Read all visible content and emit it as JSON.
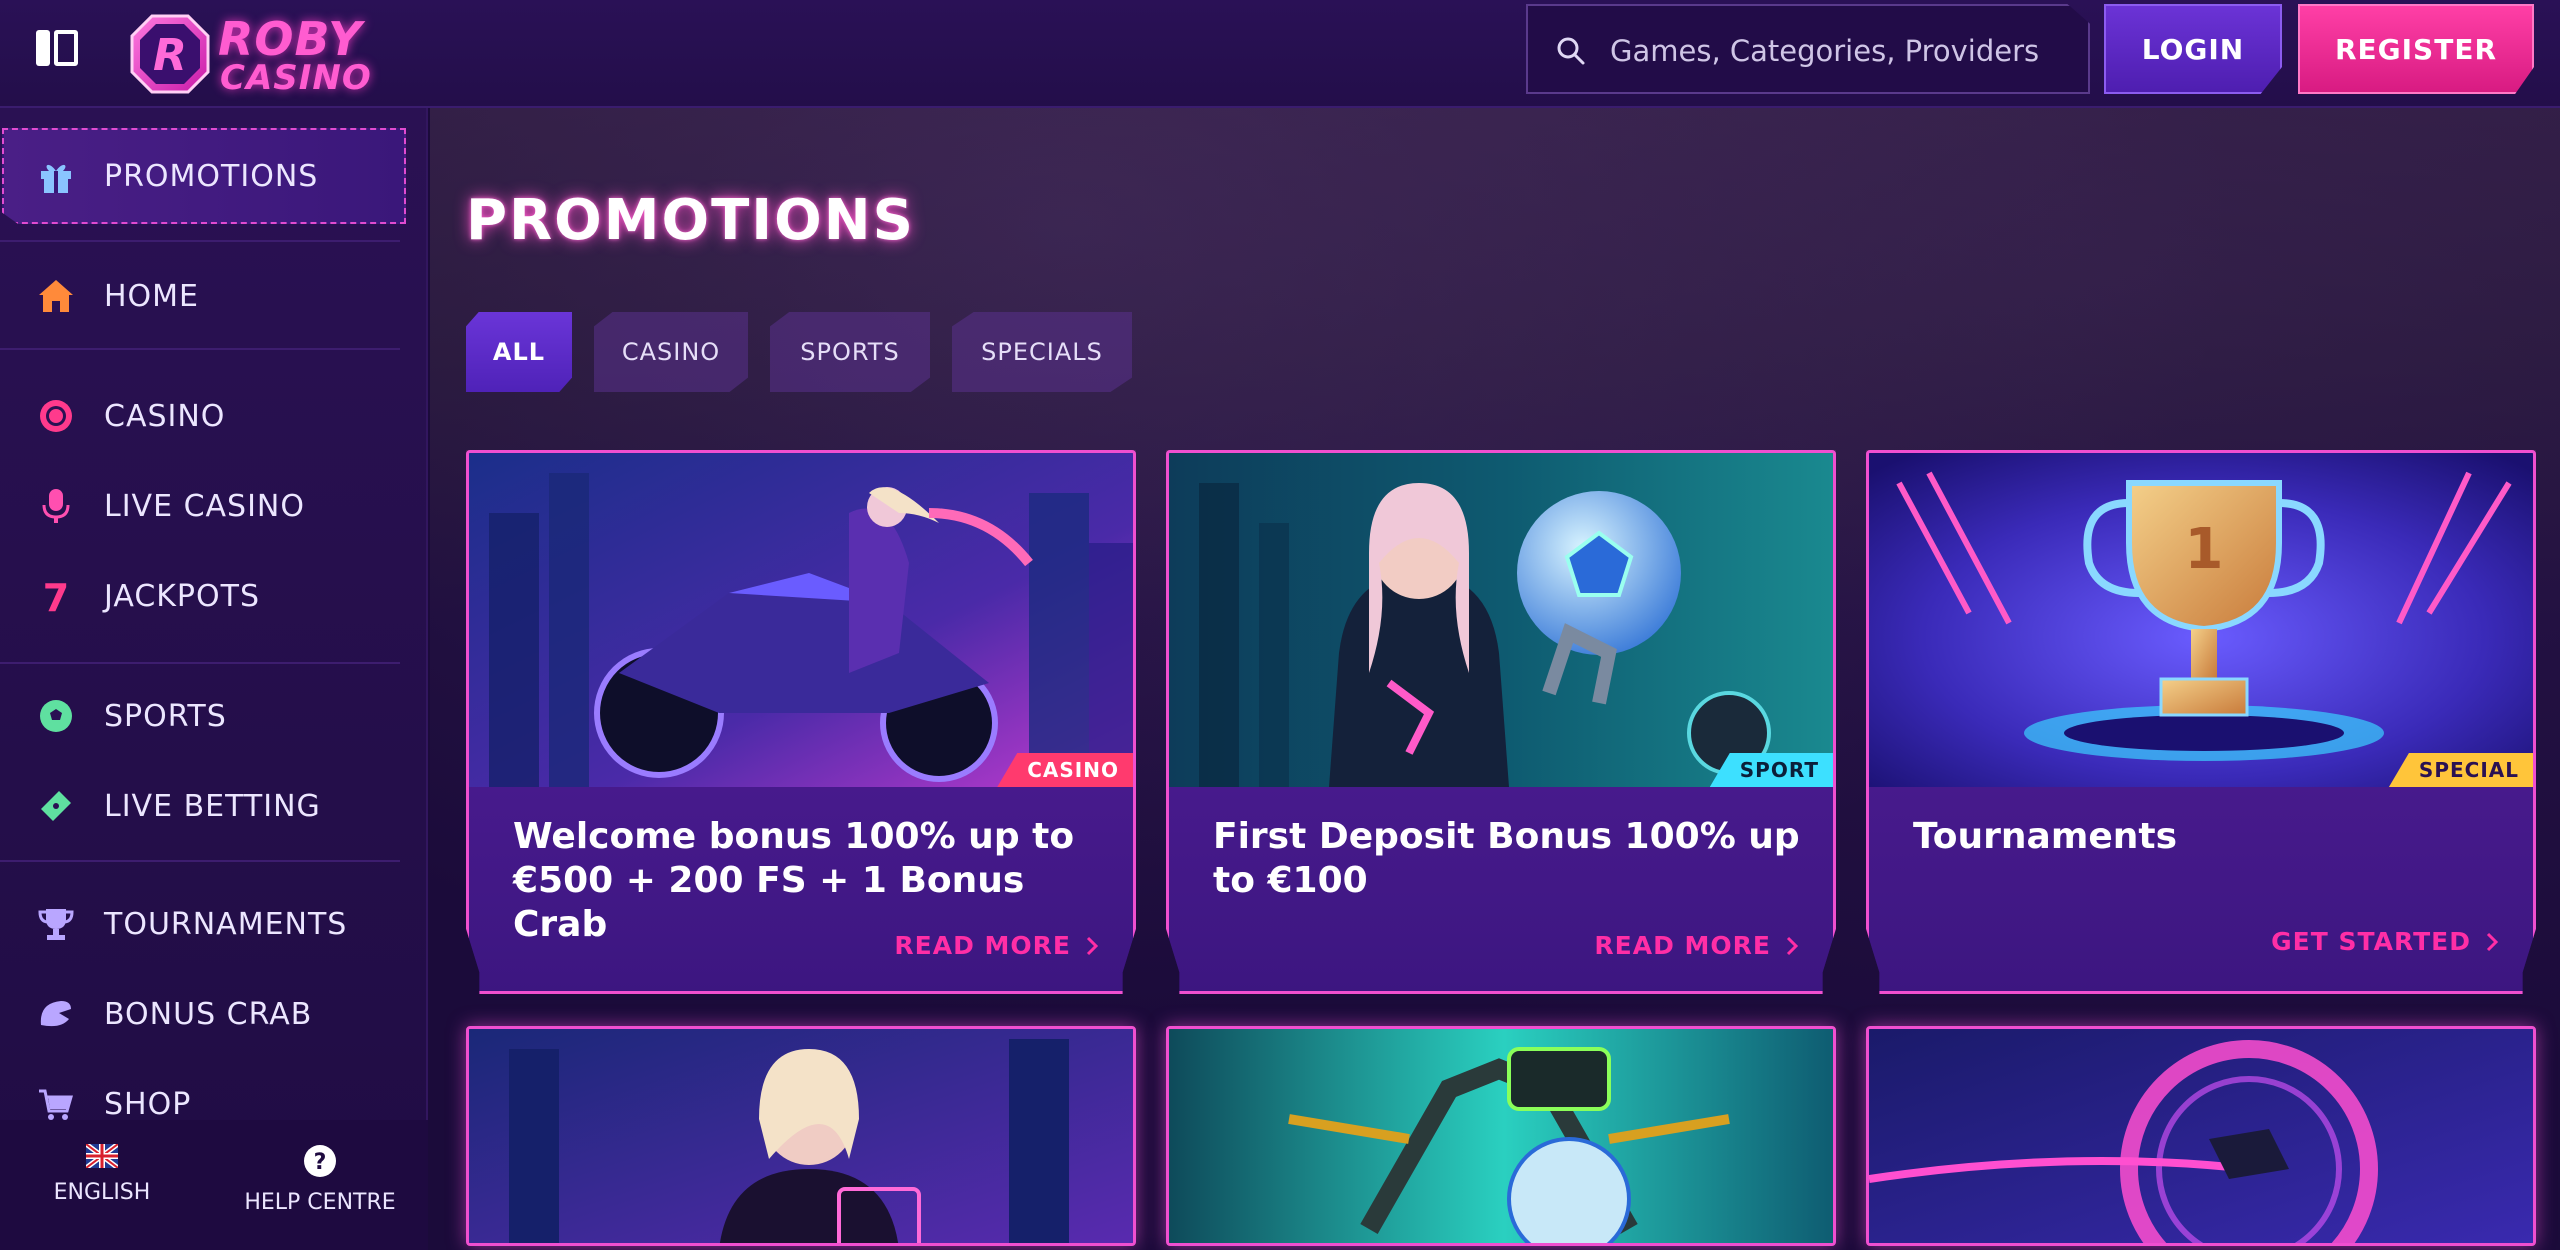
{
  "header": {
    "logo_line1": "ROBY",
    "logo_line2": "CASINO",
    "search_placeholder": "Games, Categories, Providers",
    "login_label": "LOGIN",
    "register_label": "REGISTER"
  },
  "sidebar": {
    "promo_label": "PROMOTIONS",
    "items": [
      {
        "label": "HOME",
        "icon": "home-icon"
      },
      {
        "label": "CASINO",
        "icon": "casino-chip-icon"
      },
      {
        "label": "LIVE CASINO",
        "icon": "live-casino-icon"
      },
      {
        "label": "JACKPOTS",
        "icon": "seven-icon"
      },
      {
        "label": "SPORTS",
        "icon": "soccer-ball-icon"
      },
      {
        "label": "LIVE BETTING",
        "icon": "ticket-icon"
      },
      {
        "label": "TOURNAMENTS",
        "icon": "trophy-icon"
      },
      {
        "label": "BONUS CRAB",
        "icon": "crab-claw-icon"
      },
      {
        "label": "SHOP",
        "icon": "cart-icon"
      }
    ],
    "footer": {
      "language_label": "ENGLISH",
      "help_label": "HELP CENTRE"
    }
  },
  "main": {
    "title": "PROMOTIONS",
    "tabs": [
      {
        "label": "ALL",
        "active": true
      },
      {
        "label": "CASINO",
        "active": false
      },
      {
        "label": "SPORTS",
        "active": false
      },
      {
        "label": "SPECIALS",
        "active": false
      }
    ],
    "cards": [
      {
        "title": "Welcome bonus 100% up to €500 + 200 FS + 1 Bonus Crab",
        "badge": "CASINO",
        "cta": "READ MORE"
      },
      {
        "title": "First Deposit Bonus 100% up to €100",
        "badge": "SPORT",
        "cta": "READ MORE"
      },
      {
        "title": "Tournaments",
        "badge": "SPECIAL",
        "cta": "GET STARTED"
      }
    ]
  },
  "colors": {
    "accent_pink": "#ff2ea6",
    "accent_purple": "#6a35d8",
    "badge_casino": "#ff3a6e",
    "badge_sport": "#3de0ff",
    "badge_special": "#ffc53a"
  }
}
